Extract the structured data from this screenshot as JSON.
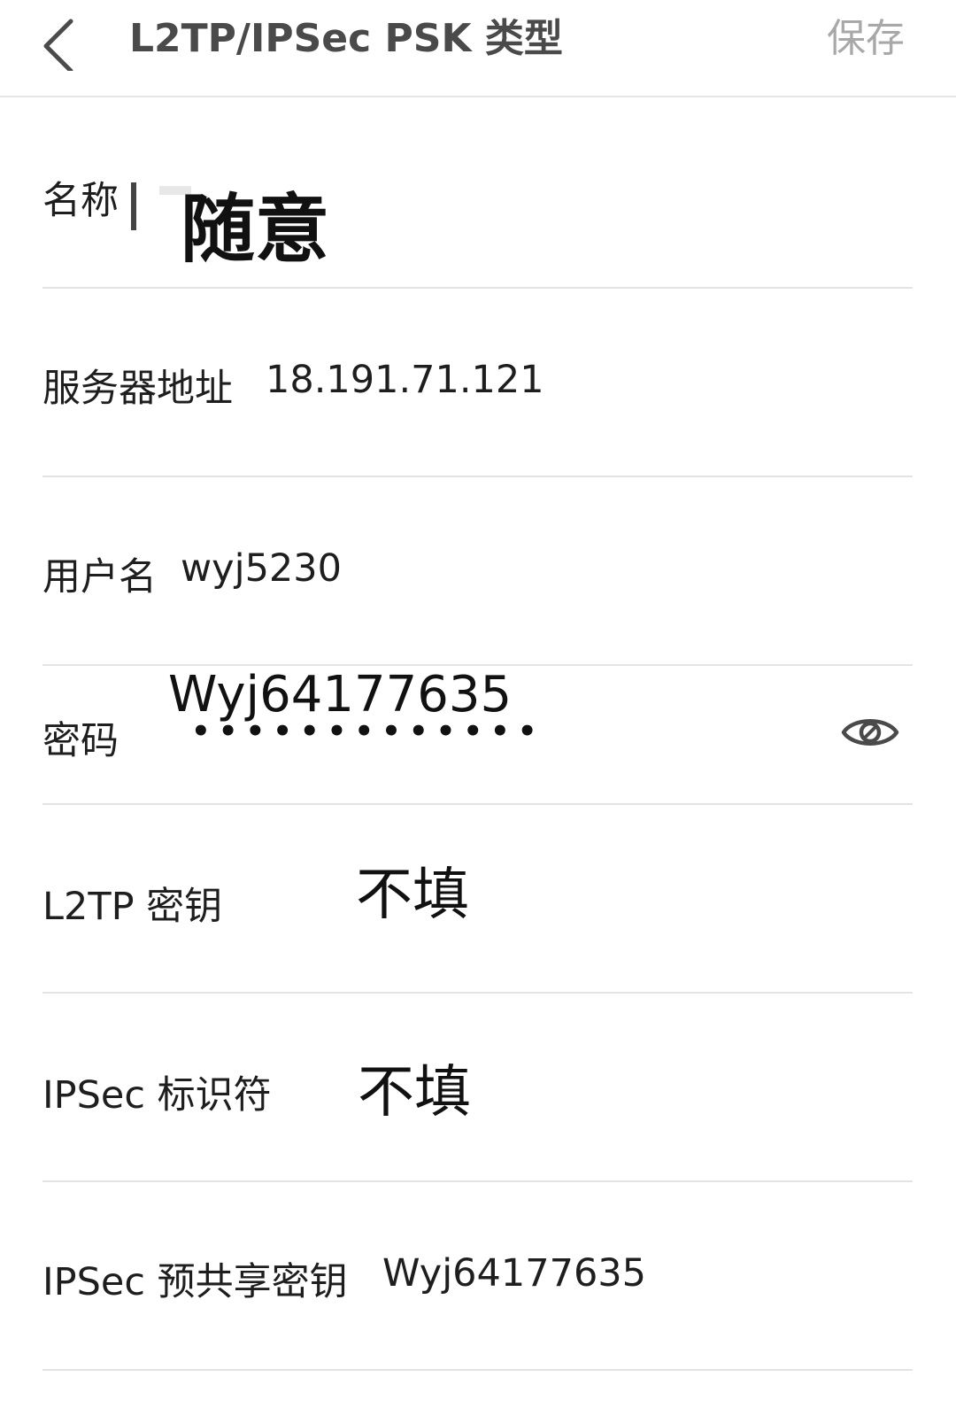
{
  "header": {
    "back_icon": "chevron-left-icon",
    "title": "L2TP/IPSec PSK 类型",
    "save_label": "保存"
  },
  "form": {
    "name": {
      "label": "名称",
      "annotation": "随意"
    },
    "server": {
      "label": "服务器地址",
      "value": "18.191.71.121"
    },
    "username": {
      "label": "用户名",
      "value": "wyj5230"
    },
    "password": {
      "label": "密码",
      "masked": "•••••••••••••",
      "annotation": "Wyj64177635",
      "toggle_icon": "eye-icon"
    },
    "l2tp_secret": {
      "label": "L2TP 密钥",
      "annotation": "不填"
    },
    "ipsec_id": {
      "label": "IPSec 标识符",
      "annotation": "不填"
    },
    "ipsec_psk": {
      "label": "IPSec 预共享密钥",
      "value": "Wyj64177635"
    }
  }
}
